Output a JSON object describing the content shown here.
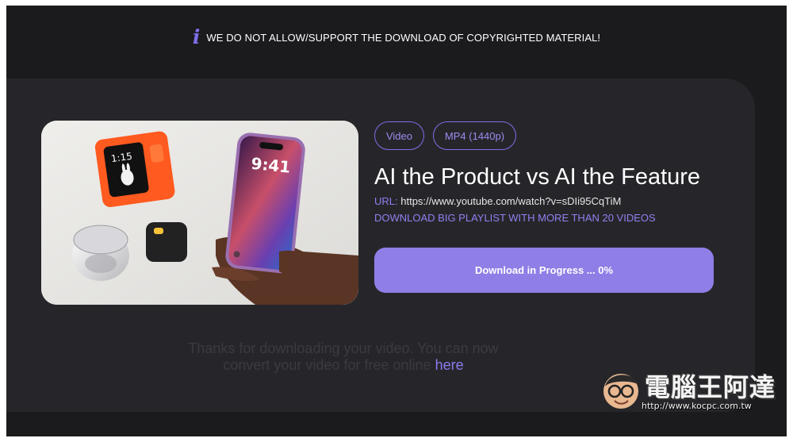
{
  "notice": {
    "icon": "info-icon",
    "text": "WE DO NOT ALLOW/SUPPORT THE DOWNLOAD OF COPYRIGHTED MATERIAL!"
  },
  "video": {
    "thumbnail_clock": "1:15",
    "phone_clock": "9:41",
    "tags": [
      "Video",
      "MP4 (1440p)"
    ],
    "title": "AI the Product vs AI the Feature",
    "url_label": "URL:",
    "url": "https://www.youtube.com/watch?v=sDIi95CqTiM",
    "playlist_link": "DOWNLOAD BIG PLAYLIST WITH MORE THAN 20 VIDEOS"
  },
  "download": {
    "button_label": "Download in Progress ... 0%",
    "progress_percent": 0
  },
  "thanks": {
    "text": "Thanks for downloading your video. You can now convert your video for free online",
    "link": "here"
  },
  "watermark": {
    "title": "電腦王阿達",
    "url": "http://www.kocpc.com.tw"
  },
  "colors": {
    "accent": "#7d6ee8",
    "button": "#8f7ee6",
    "background": "#1b1b1e",
    "card": "#26262a"
  }
}
